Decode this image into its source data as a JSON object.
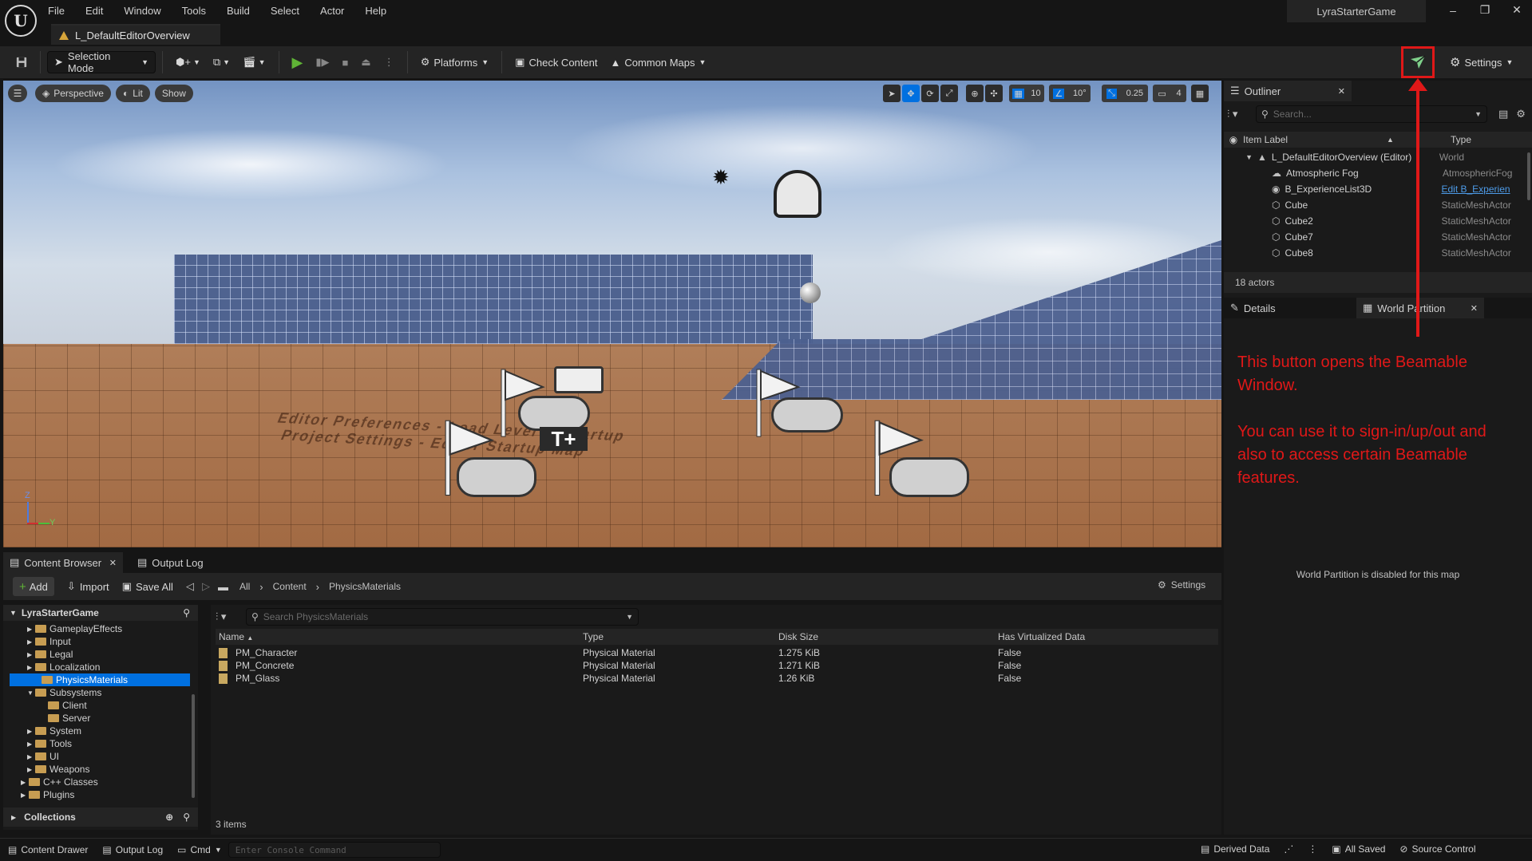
{
  "menubar": {
    "items": [
      "File",
      "Edit",
      "Window",
      "Tools",
      "Build",
      "Select",
      "Actor",
      "Help"
    ],
    "doc_tab": "L_DefaultEditorOverview",
    "project": "LyraStarterGame"
  },
  "toolbar": {
    "selection_mode": "Selection Mode",
    "platforms": "Platforms",
    "check_content": "Check Content",
    "common_maps": "Common Maps",
    "settings": "Settings"
  },
  "viewport": {
    "perspective": "Perspective",
    "lit": "Lit",
    "show": "Show",
    "grid_snap": "10",
    "rot_snap": "10°",
    "scale_snap": "0.25",
    "cam_speed": "4",
    "ground_text_1": "Editor Preferences - Load Level at Startup",
    "ground_text_2": "Project Settings - Editor Startup Map",
    "axis_z": "Z",
    "axis_y": "Y"
  },
  "outliner": {
    "tab": "Outliner",
    "search_placeholder": "Search...",
    "col_label": "Item Label",
    "col_type": "Type",
    "rows": [
      {
        "label": "L_DefaultEditorOverview (Editor)",
        "type": "World"
      },
      {
        "label": "Atmospheric Fog",
        "type": "AtmosphericFog"
      },
      {
        "label": "B_ExperienceList3D",
        "type": "Edit B_Experien"
      },
      {
        "label": "Cube",
        "type": "StaticMeshActor"
      },
      {
        "label": "Cube2",
        "type": "StaticMeshActor"
      },
      {
        "label": "Cube7",
        "type": "StaticMeshActor"
      },
      {
        "label": "Cube8",
        "type": "StaticMeshActor"
      }
    ],
    "actors_count": "18 actors"
  },
  "details": {
    "tab_details": "Details",
    "tab_world_partition": "World Partition",
    "wp_message": "World Partition is disabled for this map"
  },
  "annotation": {
    "line1": "This button opens the Beamable",
    "line2": "Window.",
    "line3": "You can use it to sign-in/up/out and",
    "line4": "also to access certain Beamable",
    "line5": "features."
  },
  "content_browser": {
    "tab": "Content Browser",
    "output_tab": "Output Log",
    "add": "Add",
    "import": "Import",
    "save_all": "Save All",
    "path": [
      "All",
      "Content",
      "PhysicsMaterials"
    ],
    "settings": "Settings",
    "root": "LyraStarterGame",
    "tree": [
      {
        "label": "GameplayEffects",
        "indent": 1
      },
      {
        "label": "Input",
        "indent": 1
      },
      {
        "label": "Legal",
        "indent": 1
      },
      {
        "label": "Localization",
        "indent": 1
      },
      {
        "label": "PhysicsMaterials",
        "indent": 1
      },
      {
        "label": "Subsystems",
        "indent": 1
      },
      {
        "label": "Client",
        "indent": 2
      },
      {
        "label": "Server",
        "indent": 2
      },
      {
        "label": "System",
        "indent": 1
      },
      {
        "label": "Tools",
        "indent": 1
      },
      {
        "label": "UI",
        "indent": 1
      },
      {
        "label": "Weapons",
        "indent": 1
      },
      {
        "label": "C++ Classes",
        "indent": 0
      },
      {
        "label": "Plugins",
        "indent": 0
      }
    ],
    "collections": "Collections",
    "search_placeholder": "Search PhysicsMaterials",
    "columns": [
      "Name",
      "Type",
      "Disk Size",
      "Has Virtualized Data"
    ],
    "rows": [
      {
        "name": "PM_Character",
        "type": "Physical Material",
        "size": "1.275 KiB",
        "virt": "False"
      },
      {
        "name": "PM_Concrete",
        "type": "Physical Material",
        "size": "1.271 KiB",
        "virt": "False"
      },
      {
        "name": "PM_Glass",
        "type": "Physical Material",
        "size": "1.26 KiB",
        "virt": "False"
      }
    ],
    "item_count": "3 items"
  },
  "statusbar": {
    "content_drawer": "Content Drawer",
    "output_log": "Output Log",
    "cmd": "Cmd",
    "console_placeholder": "Enter Console Command",
    "derived_data": "Derived Data",
    "all_saved": "All Saved",
    "source_control": "Source Control"
  },
  "colors": {
    "accent": "#0070e0",
    "annotation": "#e01818",
    "play": "#5fb336"
  }
}
